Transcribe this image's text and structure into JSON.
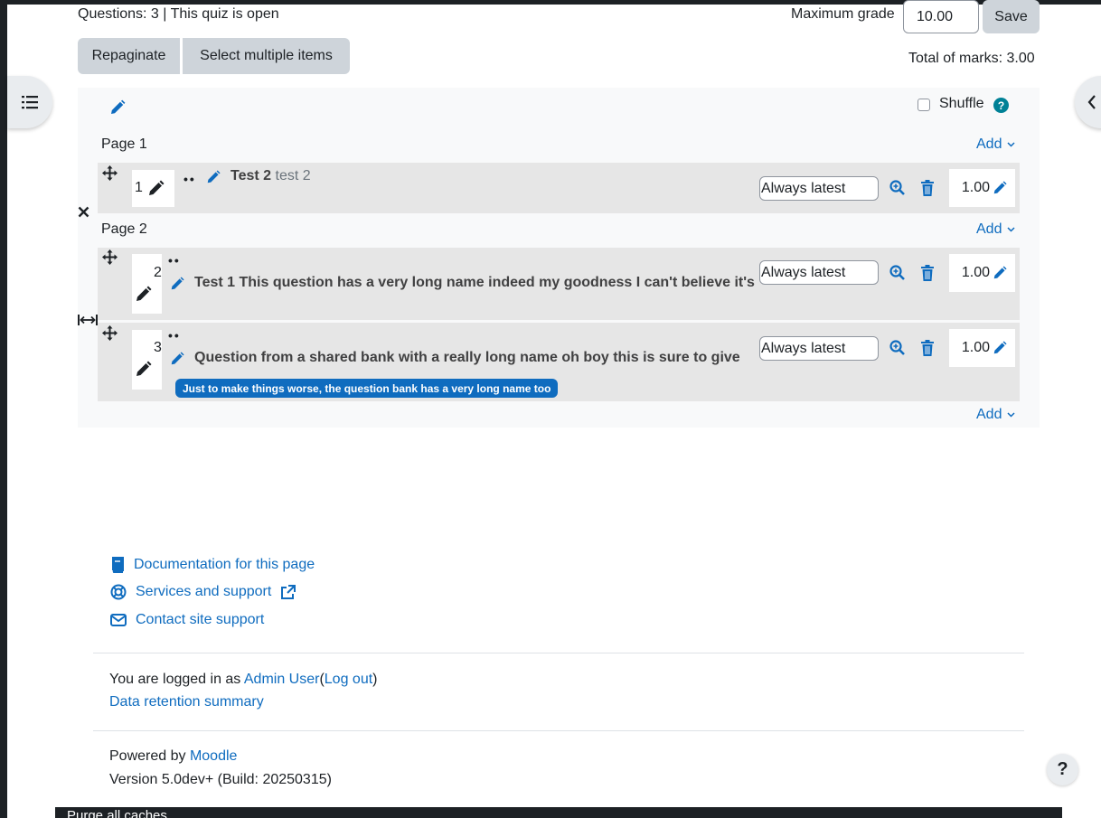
{
  "header": {
    "questions_info": "Questions: 3 | This quiz is open",
    "max_grade_label": "Maximum grade",
    "max_grade_value": "10.00",
    "save_label": "Save",
    "repaginate_label": "Repaginate",
    "select_multiple_label": "Select multiple items",
    "total_marks": "Total of marks: 3.00"
  },
  "section": {
    "shuffle_label": "Shuffle",
    "add_label": "Add",
    "pages": [
      {
        "label": "Page 1"
      },
      {
        "label": "Page 2"
      }
    ],
    "slots": [
      {
        "number": "1",
        "name": "Test 2",
        "text": "test 2",
        "version": "Always latest",
        "mark": "1.00"
      },
      {
        "number": "2",
        "name": "Test 1 This question has a very long name indeed my goodness I can't believe it's",
        "text": "",
        "version": "Always latest",
        "mark": "1.00"
      },
      {
        "number": "3",
        "name": "Question from a shared bank with a really long name oh boy this is sure to give",
        "text": "",
        "version": "Always latest",
        "mark": "1.00",
        "bank_badge": "Just to make things worse, the question bank has a very long name too"
      }
    ]
  },
  "footer": {
    "doc_link": "Documentation for this page",
    "services_link": "Services and support",
    "contact_link": "Contact site support",
    "logged_in_prefix": "You are logged in as",
    "user_name": "Admin User",
    "logout": "Log out",
    "data_retention": "Data retention summary",
    "powered_prefix": "Powered by",
    "powered_link": "Moodle",
    "version": "Version 5.0dev+ (Build: 20250315)",
    "purge_caches": "Purge all caches"
  },
  "help_button": "?",
  "colors": {
    "accent": "#0f6cbf",
    "badge": "#0f6cbf",
    "slot_bg": "#e6e6e6",
    "section_bg": "#f8f9fa"
  }
}
